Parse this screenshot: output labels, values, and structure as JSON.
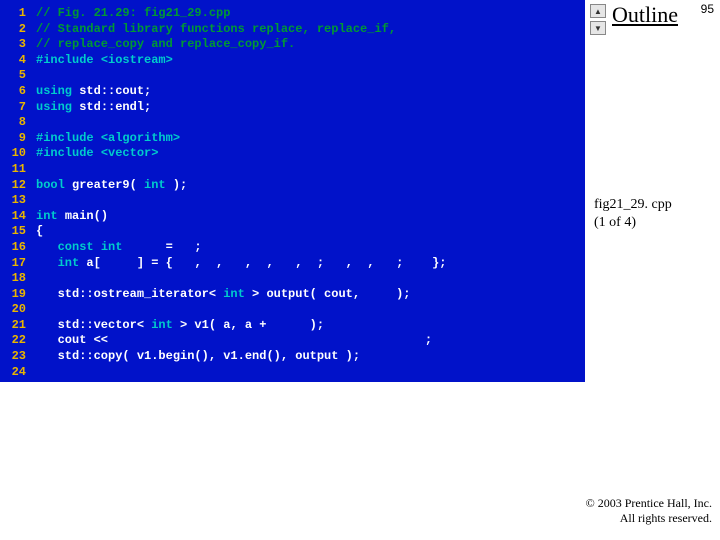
{
  "page_number": "95",
  "outline_label": "Outline",
  "nav": {
    "up_glyph": "▲",
    "down_glyph": "▼"
  },
  "caption": {
    "line1": "fig21_29. cpp",
    "line2": "(1 of 4)"
  },
  "copyright": {
    "line1": "© 2003 Prentice Hall, Inc.",
    "line2": "All rights reserved."
  },
  "code": {
    "lines": [
      {
        "n": "1",
        "seg": [
          {
            "c": "cmt",
            "t": "// Fig. 21.29: fig21_29.cpp"
          }
        ]
      },
      {
        "n": "2",
        "seg": [
          {
            "c": "cmt",
            "t": "// Standard library functions replace, replace_if,"
          }
        ]
      },
      {
        "n": "3",
        "seg": [
          {
            "c": "cmt",
            "t": "// replace_copy and replace_copy_if."
          }
        ]
      },
      {
        "n": "4",
        "seg": [
          {
            "c": "pp",
            "t": "#include "
          },
          {
            "c": "pp",
            "t": "<iostream>"
          }
        ]
      },
      {
        "n": "5",
        "seg": [
          {
            "c": "id",
            "t": ""
          }
        ]
      },
      {
        "n": "6",
        "seg": [
          {
            "c": "kw",
            "t": "using "
          },
          {
            "c": "id",
            "t": "std::cout;"
          }
        ]
      },
      {
        "n": "7",
        "seg": [
          {
            "c": "kw",
            "t": "using "
          },
          {
            "c": "id",
            "t": "std::endl;"
          }
        ]
      },
      {
        "n": "8",
        "seg": [
          {
            "c": "id",
            "t": ""
          }
        ]
      },
      {
        "n": "9",
        "seg": [
          {
            "c": "pp",
            "t": "#include "
          },
          {
            "c": "pp",
            "t": "<algorithm>"
          }
        ]
      },
      {
        "n": "10",
        "seg": [
          {
            "c": "pp",
            "t": "#include "
          },
          {
            "c": "pp",
            "t": "<vector>"
          }
        ]
      },
      {
        "n": "11",
        "seg": [
          {
            "c": "id",
            "t": ""
          }
        ]
      },
      {
        "n": "12",
        "seg": [
          {
            "c": "kw",
            "t": "bool "
          },
          {
            "c": "id",
            "t": "greater9( "
          },
          {
            "c": "kw",
            "t": "int"
          },
          {
            "c": "id",
            "t": " );"
          }
        ]
      },
      {
        "n": "13",
        "seg": [
          {
            "c": "id",
            "t": ""
          }
        ]
      },
      {
        "n": "14",
        "seg": [
          {
            "c": "kw",
            "t": "int "
          },
          {
            "c": "id",
            "t": "main()"
          }
        ]
      },
      {
        "n": "15",
        "seg": [
          {
            "c": "id",
            "t": "{"
          }
        ]
      },
      {
        "n": "16",
        "seg": [
          {
            "c": "id",
            "t": "   "
          },
          {
            "c": "kw",
            "t": "const int"
          },
          {
            "c": "id",
            "t": "      =   ;"
          }
        ]
      },
      {
        "n": "17",
        "seg": [
          {
            "c": "id",
            "t": "   "
          },
          {
            "c": "kw",
            "t": "int"
          },
          {
            "c": "id",
            "t": " a[     ] = {   ,  ,   ,  ,   ,  ;   ,  ,   ;    };"
          }
        ]
      },
      {
        "n": "18",
        "seg": [
          {
            "c": "id",
            "t": ""
          }
        ]
      },
      {
        "n": "19",
        "seg": [
          {
            "c": "id",
            "t": "   std::ostream_iterator< "
          },
          {
            "c": "kw",
            "t": "int"
          },
          {
            "c": "id",
            "t": " > output( cout,     );"
          }
        ]
      },
      {
        "n": "20",
        "seg": [
          {
            "c": "id",
            "t": ""
          }
        ]
      },
      {
        "n": "21",
        "seg": [
          {
            "c": "id",
            "t": "   std::vector< "
          },
          {
            "c": "kw",
            "t": "int"
          },
          {
            "c": "id",
            "t": " > v1( a, a +      );"
          }
        ]
      },
      {
        "n": "22",
        "seg": [
          {
            "c": "id",
            "t": "   cout <<                                            ;"
          }
        ]
      },
      {
        "n": "23",
        "seg": [
          {
            "c": "id",
            "t": "   std::copy( v1.begin(), v1.end(), output );"
          }
        ]
      },
      {
        "n": "24",
        "seg": [
          {
            "c": "id",
            "t": ""
          }
        ]
      }
    ]
  }
}
